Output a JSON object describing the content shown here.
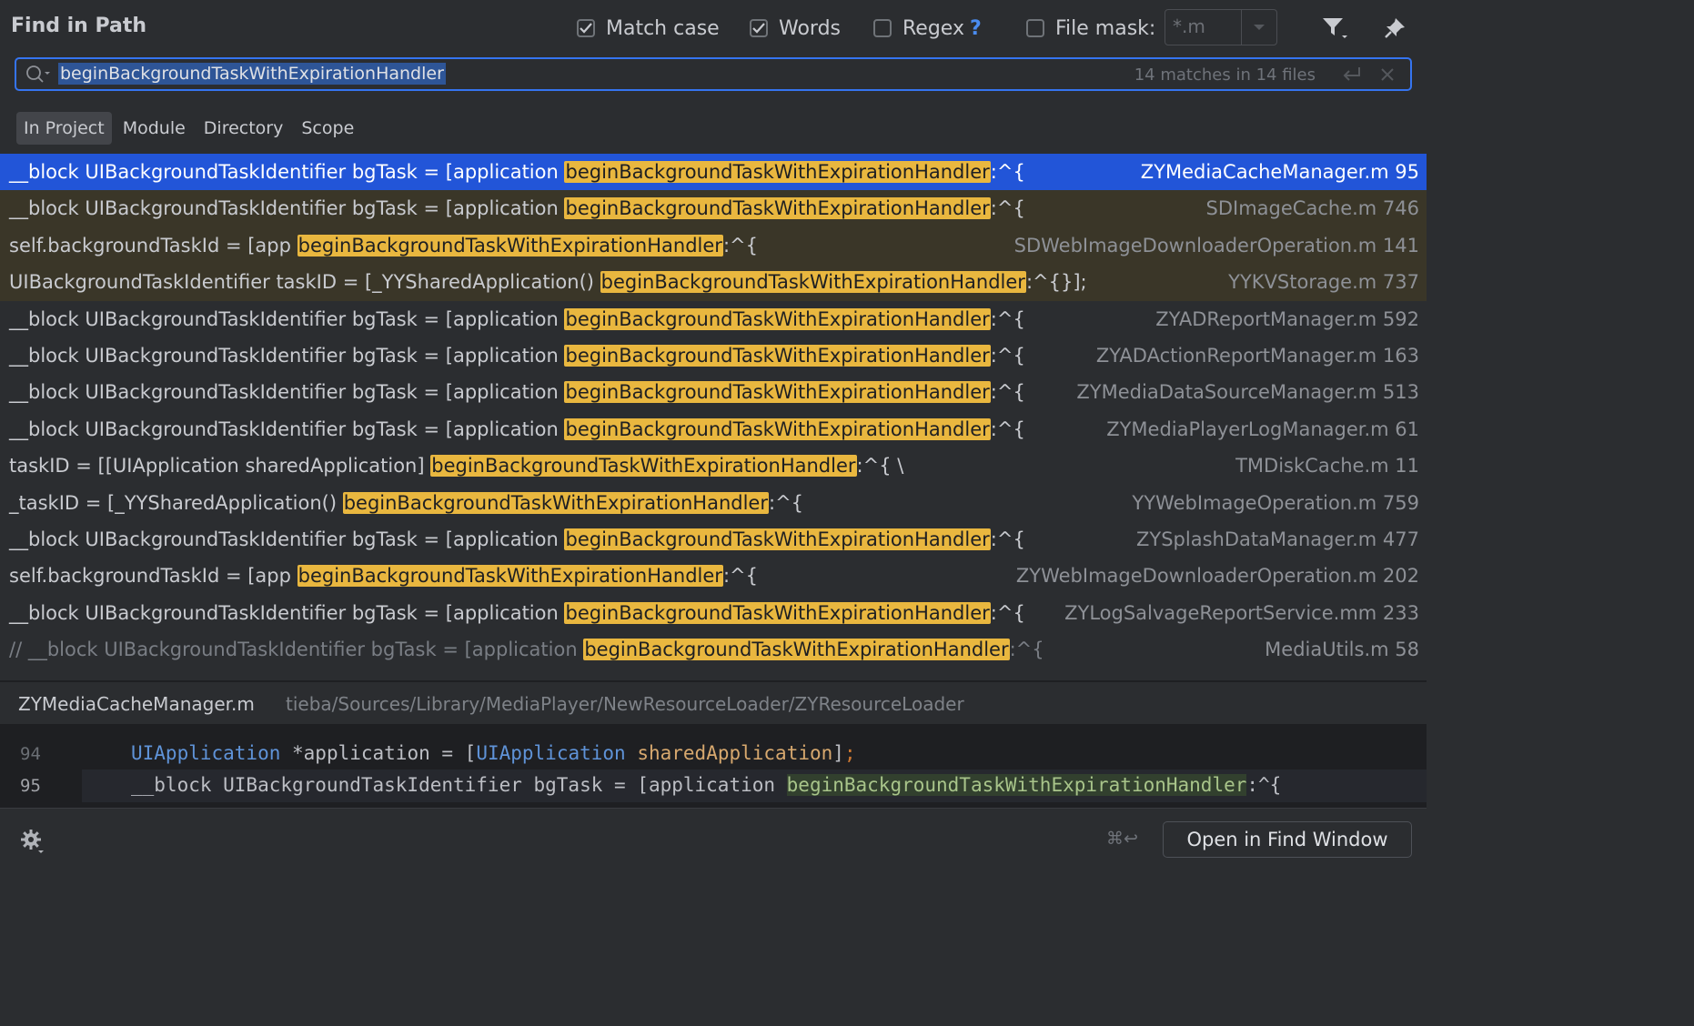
{
  "header": {
    "title": "Find in Path",
    "match_case": {
      "label": "Match case",
      "checked": true
    },
    "words": {
      "label": "Words",
      "checked": true
    },
    "regex": {
      "label": "Regex",
      "checked": false,
      "help": "?"
    },
    "file_mask": {
      "label": "File mask:",
      "checked": false,
      "value": "*.m"
    }
  },
  "search": {
    "query": "beginBackgroundTaskWithExpirationHandler",
    "count": "14 matches in 14 files"
  },
  "scopes": [
    {
      "label": "In Project",
      "active": true
    },
    {
      "label": "Module",
      "active": false
    },
    {
      "label": "Directory",
      "active": false
    },
    {
      "label": "Scope",
      "active": false
    }
  ],
  "results": [
    {
      "pre": "__block UIBackgroundTaskIdentifier bgTask = [application ",
      "match": "beginBackgroundTaskWithExpirationHandler",
      "post": ":^{",
      "file": "ZYMediaCacheManager.m 95",
      "state": "selected"
    },
    {
      "pre": "__block UIBackgroundTaskIdentifier bgTask = [application ",
      "match": "beginBackgroundTaskWithExpirationHandler",
      "post": ":^{",
      "file": "SDImageCache.m 746",
      "state": "tint"
    },
    {
      "pre": "self.backgroundTaskId = [app ",
      "match": "beginBackgroundTaskWithExpirationHandler",
      "post": ":^{",
      "file": "SDWebImageDownloaderOperation.m 141",
      "state": "tint"
    },
    {
      "pre": "UIBackgroundTaskIdentifier taskID = [_YYSharedApplication() ",
      "match": "beginBackgroundTaskWithExpirationHandler",
      "post": ":^{}];",
      "file": "YYKVStorage.m 737",
      "state": "tint"
    },
    {
      "pre": "__block UIBackgroundTaskIdentifier bgTask = [application ",
      "match": "beginBackgroundTaskWithExpirationHandler",
      "post": ":^{",
      "file": "ZYADReportManager.m 592",
      "state": "normal"
    },
    {
      "pre": "__block UIBackgroundTaskIdentifier bgTask = [application ",
      "match": "beginBackgroundTaskWithExpirationHandler",
      "post": ":^{",
      "file": "ZYADActionReportManager.m 163",
      "state": "normal"
    },
    {
      "pre": "__block UIBackgroundTaskIdentifier bgTask = [application ",
      "match": "beginBackgroundTaskWithExpirationHandler",
      "post": ":^{",
      "file": "ZYMediaDataSourceManager.m 513",
      "state": "normal"
    },
    {
      "pre": "__block UIBackgroundTaskIdentifier bgTask = [application ",
      "match": "beginBackgroundTaskWithExpirationHandler",
      "post": ":^{",
      "file": "ZYMediaPlayerLogManager.m 61",
      "state": "normal"
    },
    {
      "pre": "taskID = [[UIApplication sharedApplication] ",
      "match": "beginBackgroundTaskWithExpirationHandler",
      "post": ":^{ \\",
      "file": "TMDiskCache.m 11",
      "state": "normal"
    },
    {
      "pre": "_taskID = [_YYSharedApplication() ",
      "match": "beginBackgroundTaskWithExpirationHandler",
      "post": ":^{",
      "file": "YYWebImageOperation.m 759",
      "state": "normal"
    },
    {
      "pre": "__block UIBackgroundTaskIdentifier bgTask = [application ",
      "match": "beginBackgroundTaskWithExpirationHandler",
      "post": ":^{",
      "file": "ZYSplashDataManager.m 477",
      "state": "normal"
    },
    {
      "pre": "self.backgroundTaskId = [app ",
      "match": "beginBackgroundTaskWithExpirationHandler",
      "post": ":^{",
      "file": "ZYWebImageDownloaderOperation.m 202",
      "state": "normal"
    },
    {
      "pre": "__block UIBackgroundTaskIdentifier bgTask = [application ",
      "match": "beginBackgroundTaskWithExpirationHandler",
      "post": ":^{",
      "file": "ZYLogSalvageReportService.mm 233",
      "state": "normal"
    },
    {
      "pre": "//    __block UIBackgroundTaskIdentifier bgTask = [application ",
      "match": "beginBackgroundTaskWithExpirationHandler",
      "post": ":^{",
      "file": "MediaUtils.m 58",
      "state": "comment"
    }
  ],
  "preview": {
    "file": "ZYMediaCacheManager.m",
    "path": "tieba/Sources/Library/MediaPlayer/NewResourceLoader/ZYResourceLoader",
    "line1": {
      "num": "94",
      "type": "UIApplication",
      "mid": " *application = [",
      "type2": "UIApplication",
      "sp": " ",
      "call": "sharedApplication",
      "end": "]",
      "semi": ";"
    },
    "line2": {
      "num": "95",
      "pre": "__block UIBackgroundTaskIdentifier bgTask = [application ",
      "match": "beginBackgroundTaskWithExpirationHandler",
      "post": ":^{"
    }
  },
  "footer": {
    "shortcut": "⌘↩",
    "open_button": "Open in Find Window"
  },
  "icons": [
    "search-icon",
    "filter-icon",
    "pin-icon",
    "newline-icon",
    "clear-icon",
    "settings-gear-icon",
    "dropdown-arrow-icon"
  ],
  "colors": {
    "accent": "#3574f0",
    "selection": "#2255d8",
    "match_highlight": "#e9b73f",
    "background": "#2b2d30"
  }
}
